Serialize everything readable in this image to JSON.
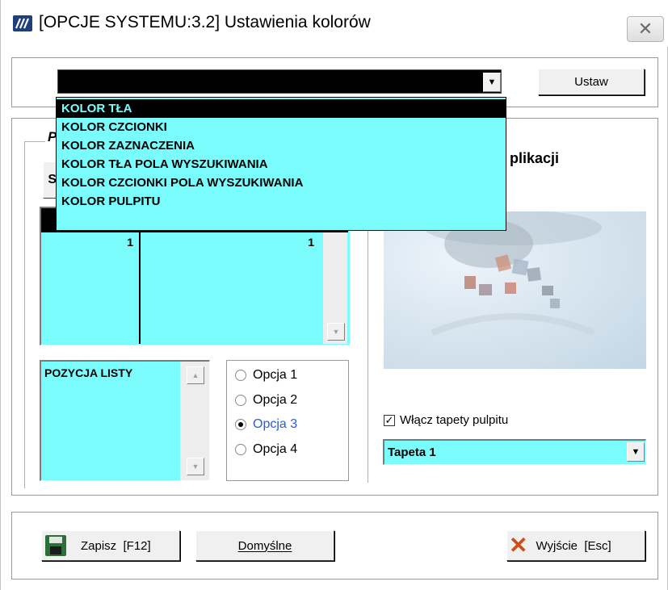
{
  "window": {
    "title": "[OPCJE SYSTEMU:3.2]  Ustawienia kolorów"
  },
  "color_select": {
    "value": "",
    "options": [
      "KOLOR TŁA",
      "KOLOR CZCIONKI",
      "KOLOR ZAZNACZENIA",
      "KOLOR TŁA POLA WYSZUKIWANIA",
      "KOLOR CZCIONKI POLA WYSZUKIWANIA",
      "KOLOR PULPITU"
    ],
    "highlighted_index": 0
  },
  "buttons": {
    "set": "Ustaw",
    "save": "Zapisz  [F12]",
    "defaults": "Domyślne",
    "exit": "Wyjście  [Esc]"
  },
  "partial": {
    "group_letter": "P",
    "button_letter": "S",
    "desktop_title_fragment": "plikacji"
  },
  "preview_grid": {
    "col1_value": "1",
    "col2_value": "1"
  },
  "list_preview": {
    "item": "POZYCJA LISTY"
  },
  "options": {
    "items": [
      "Opcja 1",
      "Opcja 2",
      "Opcja 3",
      "Opcja 4"
    ],
    "selected_index": 2
  },
  "wallpaper": {
    "checkbox_label": "Włącz tapety pulpitu",
    "checked": true,
    "select_value": "Tapeta 1"
  },
  "colors": {
    "cyan": "#7afcfc",
    "highlight_text": "#2b5bd8",
    "exit_x": "#d24a16",
    "save_icon": "#2e6e3a"
  },
  "icons": {
    "app": "app-logo-icon",
    "close": "close-icon",
    "dropdown": "chevron-down-icon",
    "save": "floppy-disk-icon",
    "exit": "x-mark-icon"
  }
}
